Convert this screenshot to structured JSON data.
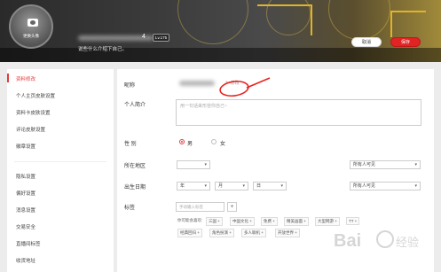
{
  "header": {
    "avatar_text": "更换头像",
    "uid_suffix": "4",
    "level": "Lv.175",
    "bio": "说些什么介绍下自己。",
    "cancel_label": "取消",
    "save_label": "保存"
  },
  "sidebar": {
    "items": [
      {
        "label": "资料修改",
        "active": true
      },
      {
        "label": "个人主页皮肤设置"
      },
      {
        "label": "资料卡皮肤设置"
      },
      {
        "label": "评论皮肤设置"
      },
      {
        "label": "徽章设置"
      },
      {
        "label": "隐私设置"
      },
      {
        "label": "偏好设置"
      },
      {
        "label": "消息设置"
      },
      {
        "label": "交易安全"
      },
      {
        "label": "直播间标签"
      },
      {
        "label": "收货地址"
      }
    ]
  },
  "form": {
    "nickname_label": "昵称",
    "nickname_edit": "修改",
    "intro_label": "个人简介",
    "intro_placeholder": "用一句话来形容你自己~",
    "gender_label": "性 别",
    "gender_male": "男",
    "gender_female": "女",
    "region_label": "所在地区",
    "region_visibility": "所有人可见",
    "birthday_label": "出生日期",
    "birth_year": "年",
    "birth_month": "月",
    "birth_day": "日",
    "birthday_visibility": "所有人可见",
    "tags_label": "标签",
    "tag_input_placeholder": "手动输入标签",
    "tag_add": "+",
    "tag_hint": "你可能会喜欢:",
    "tags": [
      "三国",
      "中国文化",
      "免费",
      "精美画面",
      "大型网游",
      "TT",
      "经典回归",
      "角色扮演",
      "多人联机",
      "开放世界"
    ]
  },
  "colors": {
    "accent": "#e23c3c",
    "save_button": "#e02424"
  },
  "watermark": "Bai 经验"
}
